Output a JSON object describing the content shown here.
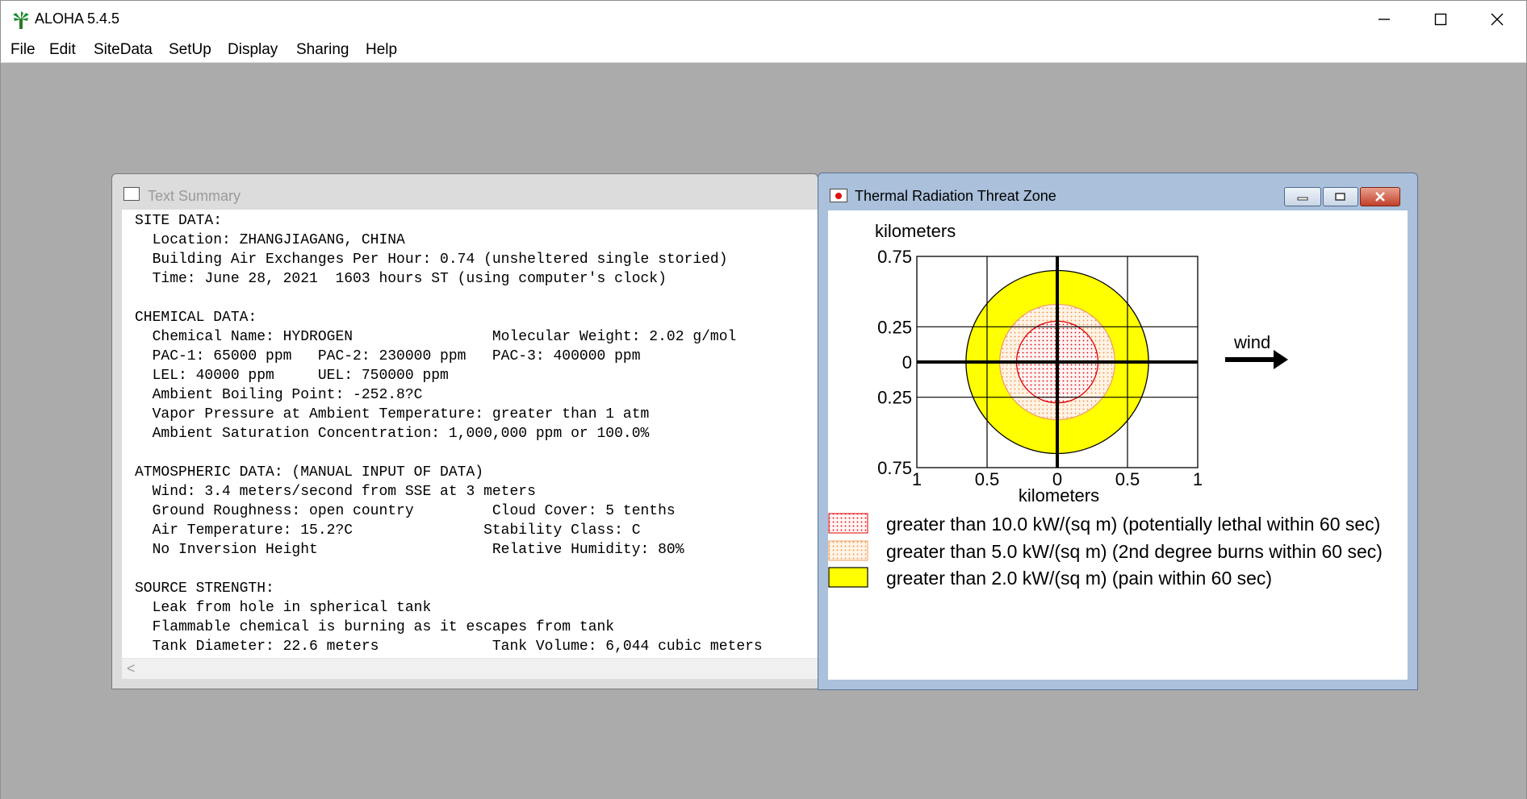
{
  "app": {
    "title": "ALOHA 5.4.5",
    "menu": [
      "File",
      "Edit",
      "SiteData",
      "SetUp",
      "Display",
      "Sharing",
      "Help"
    ]
  },
  "text_summary": {
    "title": "Text Summary",
    "lines": [
      "SITE DATA:",
      "  Location: ZHANGJIAGANG, CHINA",
      "  Building Air Exchanges Per Hour: 0.74 (unsheltered single storied)",
      "  Time: June 28, 2021  1603 hours ST (using computer's clock)",
      "",
      "CHEMICAL DATA:",
      "  Chemical Name: HYDROGEN                Molecular Weight: 2.02 g/mol",
      "  PAC-1: 65000 ppm   PAC-2: 230000 ppm   PAC-3: 400000 ppm",
      "  LEL: 40000 ppm     UEL: 750000 ppm",
      "  Ambient Boiling Point: -252.8?C",
      "  Vapor Pressure at Ambient Temperature: greater than 1 atm",
      "  Ambient Saturation Concentration: 1,000,000 ppm or 100.0%",
      "",
      "ATMOSPHERIC DATA: (MANUAL INPUT OF DATA)",
      "  Wind: 3.4 meters/second from SSE at 3 meters",
      "  Ground Roughness: open country         Cloud Cover: 5 tenths",
      "  Air Temperature: 15.2?C               Stability Class: C",
      "  No Inversion Height                    Relative Humidity: 80%",
      "",
      "SOURCE STRENGTH:",
      "  Leak from hole in spherical tank",
      "  Flammable chemical is burning as it escapes from tank",
      "  Tank Diameter: 22.6 meters             Tank Volume: 6,044 cubic meters"
    ],
    "scroll_left_glyph": "<"
  },
  "threat_zone": {
    "title": "Thermal Radiation Threat Zone",
    "y_axis_label": "kilometers",
    "x_axis_label": "kilometers",
    "y_ticks": [
      {
        "label": "0.75",
        "value": 0.75
      },
      {
        "label": "0.25",
        "value": 0.25
      },
      {
        "label": "0",
        "value": 0
      },
      {
        "label": "0.25",
        "value": -0.25
      },
      {
        "label": "0.75",
        "value": -0.75
      }
    ],
    "x_ticks": [
      {
        "label": "1",
        "value": -1
      },
      {
        "label": "0.5",
        "value": -0.5
      },
      {
        "label": "0",
        "value": 0
      },
      {
        "label": "0.5",
        "value": 0.5
      },
      {
        "label": "1",
        "value": 1
      }
    ],
    "x_range": [
      -1,
      1
    ],
    "y_range": [
      -0.75,
      0.75
    ],
    "wind_label": "wind",
    "zones": [
      {
        "radius_km": 0.65,
        "fill": "#ffff00",
        "stroke": "#000000",
        "pattern": "none"
      },
      {
        "radius_km": 0.41,
        "fill": "#fce4c8",
        "stroke": "#f0a060",
        "pattern": "dots-orange"
      },
      {
        "radius_km": 0.29,
        "fill": "#fde8ea",
        "stroke": "#e00000",
        "pattern": "dots-red"
      }
    ],
    "legend": [
      {
        "label": "greater than 10.0 kW/(sq m) (potentially lethal within 60 sec)",
        "pattern": "dots-red"
      },
      {
        "label": "greater than 5.0 kW/(sq m) (2nd degree burns within 60 sec)",
        "pattern": "dots-orange"
      },
      {
        "label": "greater than 2.0 kW/(sq m) (pain within 60 sec)",
        "pattern": "yellow"
      }
    ]
  }
}
